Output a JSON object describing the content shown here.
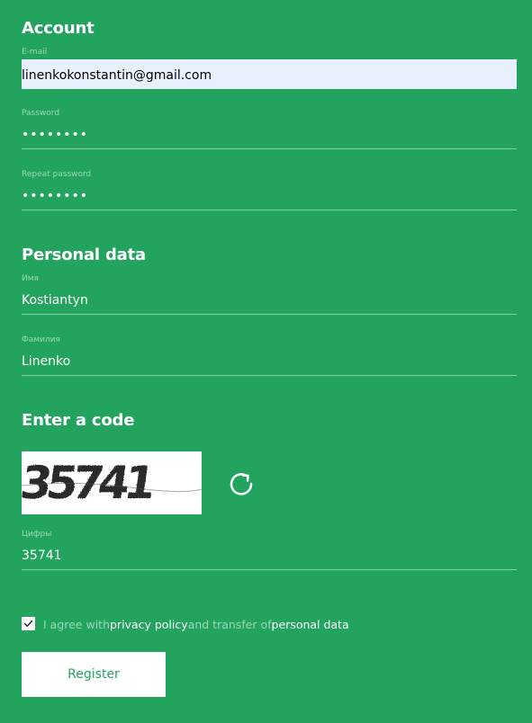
{
  "account": {
    "title": "Account",
    "email_label": "E-mail",
    "email_value": "linenkokonstantin@gmail.com",
    "password_label": "Password",
    "password_value": "••••••••",
    "repeat_password_label": "Repeat password",
    "repeat_password_value": "••••••••"
  },
  "personal": {
    "title": "Personal data",
    "first_name_label": "Имя",
    "first_name_value": "Kostiantyn",
    "last_name_label": "Фамилия",
    "last_name_value": "Linenko"
  },
  "code": {
    "title": "Enter a code",
    "captcha_text": "35741",
    "digits_label": "Цифры",
    "digits_value": "35741"
  },
  "agreement": {
    "checked": true,
    "prefix": "I agree with",
    "privacy_link": "privacy policy",
    "middle": "and transfer of",
    "personal_data_link": "personal data"
  },
  "register_label": "Register",
  "colors": {
    "background": "#22a45e",
    "autofill": "#e8f0fe"
  }
}
